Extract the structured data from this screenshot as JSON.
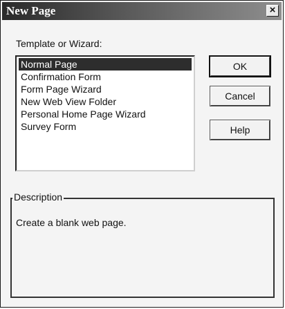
{
  "window": {
    "title": "New Page",
    "close_glyph": "×"
  },
  "template_label": "Template or Wizard:",
  "templates": [
    {
      "label": "Normal Page",
      "selected": true
    },
    {
      "label": "Confirmation Form",
      "selected": false
    },
    {
      "label": "Form Page Wizard",
      "selected": false
    },
    {
      "label": "New Web View Folder",
      "selected": false
    },
    {
      "label": "Personal Home Page Wizard",
      "selected": false
    },
    {
      "label": "Survey Form",
      "selected": false
    }
  ],
  "buttons": {
    "ok": "OK",
    "cancel": "Cancel",
    "help": "Help"
  },
  "description": {
    "legend": "Description",
    "text": "Create a blank web page."
  }
}
